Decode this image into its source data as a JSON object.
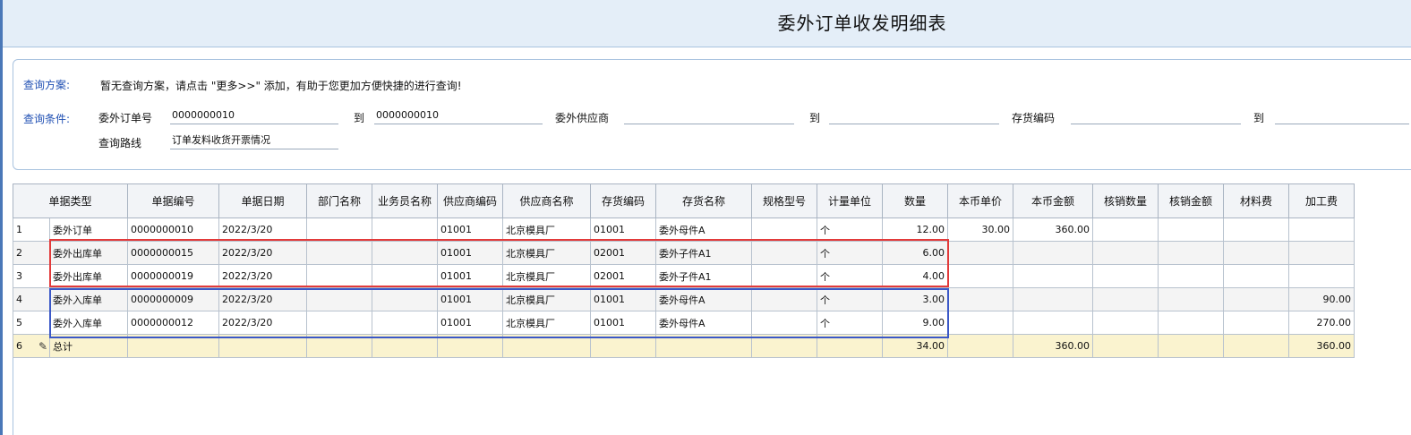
{
  "page": {
    "title": "委外订单收发明细表"
  },
  "query": {
    "scheme_label": "查询方案:",
    "scheme_text": "暂无查询方案，请点击 \"更多>>\" 添加，有助于您更加方便快捷的进行查询!",
    "condition_label": "查询条件:",
    "order_no_label": "委外订单号",
    "order_no_from": "0000000010",
    "to1": "到",
    "order_no_to": "0000000010",
    "supplier_label": "委外供应商",
    "supplier_from": "",
    "to2": "到",
    "supplier_to": "",
    "inventory_label": "存货编码",
    "inventory_from": "",
    "to3": "到",
    "inventory_to": "",
    "route_label": "查询路线",
    "route_value": "订单发料收货开票情况"
  },
  "table": {
    "headers": [
      "单据类型",
      "单据编号",
      "单据日期",
      "部门名称",
      "业务员名称",
      "供应商编码",
      "供应商名称",
      "存货编码",
      "存货名称",
      "规格型号",
      "计量单位",
      "数量",
      "本币单价",
      "本币金额",
      "核销数量",
      "核销金额",
      "材料费",
      "加工费"
    ],
    "rows": [
      {
        "no": "1",
        "type": "委外订单",
        "doc_no": "0000000010",
        "date": "2022/3/20",
        "dept": "",
        "staff": "",
        "sup_code": "01001",
        "sup_name": "北京模具厂",
        "inv_code": "01001",
        "inv_name": "委外母件A",
        "spec": "",
        "unit": "个",
        "qty": "12.00",
        "price": "30.00",
        "amount": "360.00",
        "wo_qty": "",
        "wo_amt": "",
        "material": "",
        "process": ""
      },
      {
        "no": "2",
        "type": "委外出库单",
        "doc_no": "0000000015",
        "date": "2022/3/20",
        "dept": "",
        "staff": "",
        "sup_code": "01001",
        "sup_name": "北京模具厂",
        "inv_code": "02001",
        "inv_name": "委外子件A1",
        "spec": "",
        "unit": "个",
        "qty": "6.00",
        "price": "",
        "amount": "",
        "wo_qty": "",
        "wo_amt": "",
        "material": "",
        "process": ""
      },
      {
        "no": "3",
        "type": "委外出库单",
        "doc_no": "0000000019",
        "date": "2022/3/20",
        "dept": "",
        "staff": "",
        "sup_code": "01001",
        "sup_name": "北京模具厂",
        "inv_code": "02001",
        "inv_name": "委外子件A1",
        "spec": "",
        "unit": "个",
        "qty": "4.00",
        "price": "",
        "amount": "",
        "wo_qty": "",
        "wo_amt": "",
        "material": "",
        "process": ""
      },
      {
        "no": "4",
        "type": "委外入库单",
        "doc_no": "0000000009",
        "date": "2022/3/20",
        "dept": "",
        "staff": "",
        "sup_code": "01001",
        "sup_name": "北京模具厂",
        "inv_code": "01001",
        "inv_name": "委外母件A",
        "spec": "",
        "unit": "个",
        "qty": "3.00",
        "price": "",
        "amount": "",
        "wo_qty": "",
        "wo_amt": "",
        "material": "",
        "process": "90.00"
      },
      {
        "no": "5",
        "type": "委外入库单",
        "doc_no": "0000000012",
        "date": "2022/3/20",
        "dept": "",
        "staff": "",
        "sup_code": "01001",
        "sup_name": "北京模具厂",
        "inv_code": "01001",
        "inv_name": "委外母件A",
        "spec": "",
        "unit": "个",
        "qty": "9.00",
        "price": "",
        "amount": "",
        "wo_qty": "",
        "wo_amt": "",
        "material": "",
        "process": "270.00"
      }
    ],
    "total": {
      "no": "6",
      "label": "总计",
      "qty": "34.00",
      "amount": "360.00",
      "process": "360.00"
    }
  },
  "highlights": {
    "red": "#e23a3a",
    "blue": "#3b58c7"
  }
}
